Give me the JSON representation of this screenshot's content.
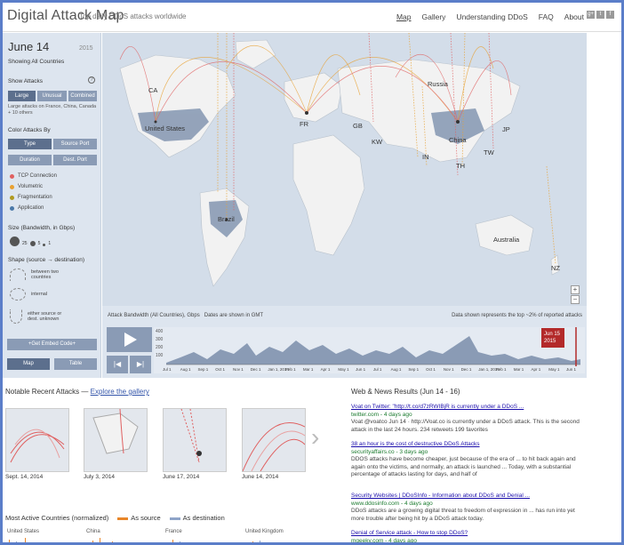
{
  "header": {
    "logo": "Digital Attack Map",
    "tagline": "Top daily DDoS attacks worldwide",
    "nav": [
      "Map",
      "Gallery",
      "Understanding DDoS",
      "FAQ",
      "About"
    ],
    "social_icons": [
      "g+",
      "twitter-icon",
      "facebook-icon"
    ]
  },
  "sidebar": {
    "date": "June 14",
    "year": "2015",
    "showing": "Showing All Countries",
    "show_attacks_label": "Show Attacks",
    "attack_buttons": [
      "Large",
      "Unusual",
      "Combined"
    ],
    "note": "Large attacks on France, China, Canada + 10 others",
    "color_by_label": "Color Attacks By",
    "color_buttons": [
      "Type",
      "Source Port",
      "Duration",
      "Dest. Port"
    ],
    "legend": [
      {
        "label": "TCP Connection",
        "color": "#e06060"
      },
      {
        "label": "Volumetric",
        "color": "#e8a030"
      },
      {
        "label": "Fragmentation",
        "color": "#b09a20"
      },
      {
        "label": "Application",
        "color": "#4a78a8"
      }
    ],
    "size_label": "Size (Bandwidth, in Gbps)",
    "size_values": [
      "25",
      "5",
      "1"
    ],
    "shape_label": "Shape (source → destination)",
    "shapes": [
      "between two countries",
      "internal",
      "either source or dest. unknown"
    ],
    "embed_label": "+Get Embed Code+",
    "view_tabs": [
      "Map",
      "Table"
    ]
  },
  "map": {
    "labels": [
      "United States",
      "Brazil",
      "Russia",
      "China",
      "Australia",
      "KW",
      "TW",
      "JP",
      "IN",
      "TH",
      "FR",
      "NZ",
      "GB",
      "CA"
    ]
  },
  "timeline": {
    "title": "Attack Bandwidth (All Countries), Gbps",
    "subtitle": "Dates are shown in GMT",
    "note": "Data shown represents the top ~2% of reported attacks",
    "marker": "Jun 15 2015",
    "y_ticks": [
      "400",
      "300",
      "200",
      "100"
    ],
    "x_ticks": [
      "Jul 1",
      "Aug 1",
      "Sep 1",
      "Oct 1",
      "Nov 1",
      "Dec 1",
      "Jan 1, 2014",
      "Feb 1",
      "Mar 1",
      "Apr 1",
      "May 1",
      "Jun 1",
      "Jul 1",
      "Aug 1",
      "Sep 1",
      "Oct 1",
      "Nov 1",
      "Dec 1",
      "Jan 1, 2015",
      "Feb 1",
      "Mar 1",
      "Apr 1",
      "May 1",
      "Jun 1"
    ]
  },
  "recent": {
    "title": "Notable Recent Attacks —",
    "link": "Explore the gallery",
    "items": [
      {
        "date": "Sept. 14, 2014"
      },
      {
        "date": "July 3, 2014"
      },
      {
        "date": "June 17, 2014"
      },
      {
        "date": "June 14, 2014"
      }
    ]
  },
  "active_countries": {
    "title": "Most Active Countries (normalized)",
    "as_source": "As source",
    "as_destination": "As destination",
    "source_color": "#e8862a",
    "destination_color": "#8ea4c8",
    "countries": [
      "United States",
      "China",
      "France",
      "United Kingdom"
    ]
  },
  "web_results": {
    "title": "Web & News Results (Jun 14 - 16)",
    "items": [
      {
        "title": "Voat on Twitter: \"http://t.co/d7zRWIBjR is currently under a DDoS ...",
        "url": "twitter.com - 4 days ago",
        "snippet": "Voat @voatco Jun 14 · http://Voat.co is currently under a DDoS attack. This is the second attack in the last 24 hours. 234 retweets 199 favorites"
      },
      {
        "title": "38 an hour is the cost of destructive DDoS Attacks",
        "url": "securityaffairs.co - 3 days ago",
        "snippet": "DDOS attacks have become cheaper, just because of the era of ... to hit back again and again onto the victims, and normally, an attack is launched ... Today, with a substantial percentage of attacks lasting for days, and half of"
      },
      {
        "title": "Security Websites | DDoSInfo - Information about DDoS and Denial ...",
        "url": "www.ddosinfo.com - 4 days ago",
        "snippet": "DDoS attacks are a growing digital threat to freedom of expression in ... has run into yet more trouble after being hit by a DDoS attack today."
      },
      {
        "title": "Denial of Service attack - How to stop DDoS?",
        "url": "mgeeky.com - 4 days ago",
        "snippet": ""
      }
    ]
  }
}
